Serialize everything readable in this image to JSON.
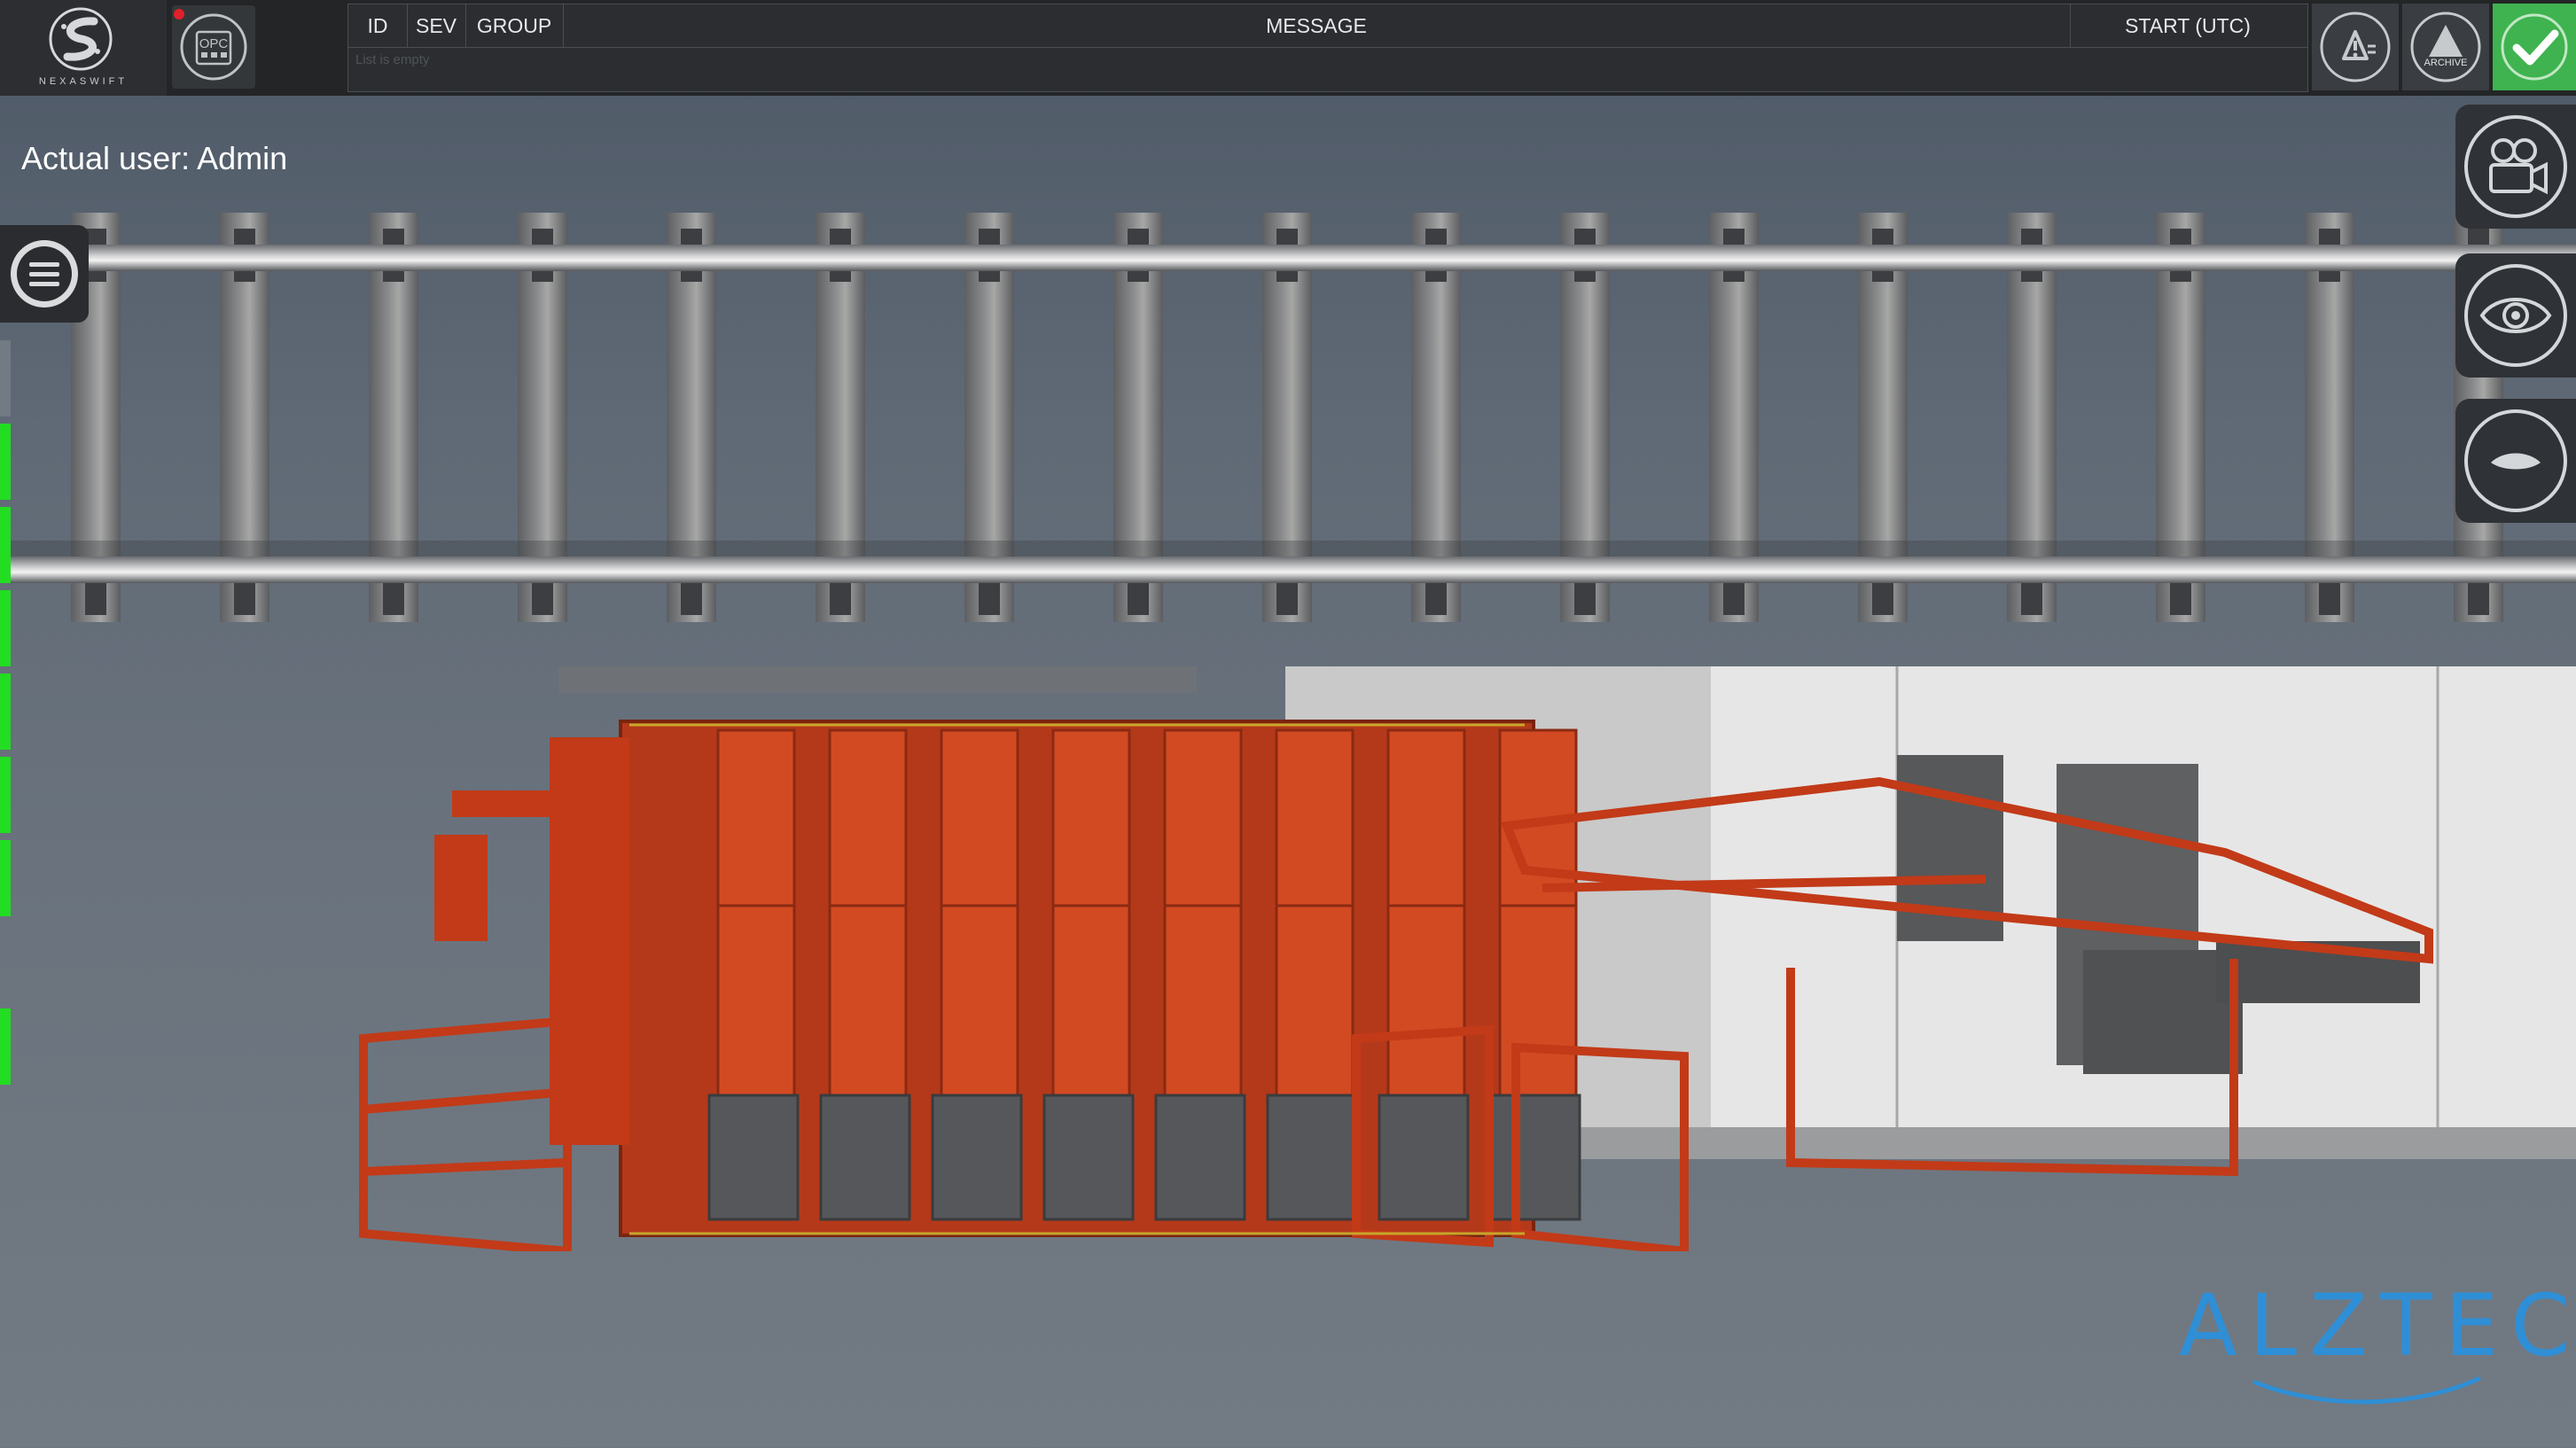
{
  "app": {
    "name": "NEXASWIFT"
  },
  "toolbar": {
    "opc_label": "OPC",
    "alarm_table": {
      "columns": [
        "ID",
        "SEV",
        "GROUP",
        "MESSAGE",
        "START (UTC)"
      ],
      "empty_message": "List is empty"
    },
    "alarm_button": "alarm-list-icon",
    "archive_button": "ARCHIVE",
    "acknowledge_button": "checkmark-icon"
  },
  "user": {
    "prefix": "Actual user:",
    "name": "Admin"
  },
  "side_controls": [
    "camera-icon",
    "eye-icon",
    "eye-closed-icon"
  ],
  "status_indicators": {
    "color": "#22dd22",
    "count": 7
  },
  "brand": {
    "name": "ALZTEC",
    "color": "#2f8fd6"
  },
  "colors": {
    "accent_ok": "#3fb34f",
    "car_frame": "#c23a18",
    "alert_dot": "#e0202a"
  }
}
